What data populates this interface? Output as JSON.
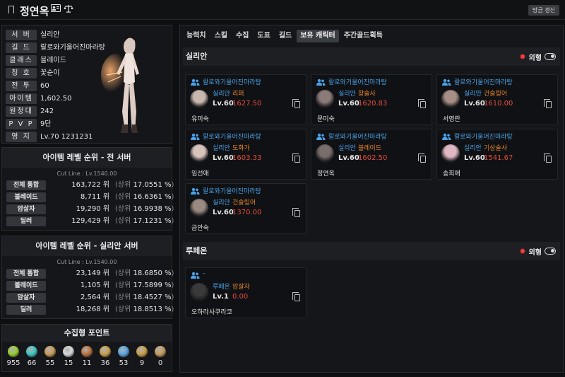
{
  "header": {
    "character_name": "정연옥",
    "refresh_label": "방금 갱신"
  },
  "profile": {
    "rows": [
      {
        "label": "서 버",
        "value": "실리안"
      },
      {
        "label": "길 드",
        "value": "랄로와기울어진마라탕"
      },
      {
        "label": "클래스",
        "value": "블레이드"
      },
      {
        "label": "칭 호",
        "value": "꽃순이"
      },
      {
        "label": "전 투",
        "value": "60"
      },
      {
        "label": "아이템",
        "value": "1,602.50"
      },
      {
        "label": "원정대",
        "value": "242"
      },
      {
        "label": "P V P",
        "value": "9단"
      },
      {
        "label": "영 지",
        "value": "Lv.70 1231231"
      }
    ]
  },
  "rank_all": {
    "title": "아이템 레벨 순위 - 전 서버",
    "cutline": "Cut Line : Lv.1540.00",
    "rows": [
      {
        "label": "전체 통합",
        "rank": "163,722",
        "unit": "위",
        "pct": "17.0551 %"
      },
      {
        "label": "블레이드",
        "rank": "8,711",
        "unit": "위",
        "pct": "16.6361 %"
      },
      {
        "label": "암살자",
        "rank": "19,290",
        "unit": "위",
        "pct": "16.9938 %"
      },
      {
        "label": "딜러",
        "rank": "129,429",
        "unit": "위",
        "pct": "17.1231 %"
      }
    ]
  },
  "rank_server": {
    "title": "아이템 레벨 순위 - 실리안 서버",
    "cutline": "Cut Line : Lv.1540.00",
    "rows": [
      {
        "label": "전체 통합",
        "rank": "23,149",
        "unit": "위",
        "pct": "18.6850 %"
      },
      {
        "label": "블레이드",
        "rank": "1,105",
        "unit": "위",
        "pct": "17.5899 %"
      },
      {
        "label": "암살자",
        "rank": "2,564",
        "unit": "위",
        "pct": "18.4527 %"
      },
      {
        "label": "딜러",
        "rank": "18,268",
        "unit": "위",
        "pct": "18.8513 %"
      }
    ]
  },
  "pct_prefix": "(상위",
  "pct_suffix": ")",
  "collect": {
    "title": "수집형 포인트",
    "items": [
      {
        "icon": "mokoko-seed-icon",
        "count": "955",
        "color": "#9acd32"
      },
      {
        "icon": "island-heart-icon",
        "count": "66",
        "color": "#3ec6c0"
      },
      {
        "icon": "great-art-icon",
        "count": "55",
        "color": "#c89b5a"
      },
      {
        "icon": "giant-heart-icon",
        "count": "15",
        "color": "#d9d9d9"
      },
      {
        "icon": "ignea-token-icon",
        "count": "11",
        "color": "#b8733e"
      },
      {
        "icon": "sea-bounty-icon",
        "count": "36",
        "color": "#c9a04a"
      },
      {
        "icon": "orpheus-star-icon",
        "count": "53",
        "color": "#5aa6e0"
      },
      {
        "icon": "world-tree-leaf-icon",
        "count": "9",
        "color": "#c9a04a"
      },
      {
        "icon": "omnium-star-icon",
        "count": "0",
        "color": "#c49a5c"
      }
    ]
  },
  "tabs": [
    "능력치",
    "스킬",
    "수집",
    "도표",
    "길드",
    "보유 캐릭터",
    "주간골드획득"
  ],
  "active_tab": 5,
  "servers": [
    {
      "name": "실리안",
      "appearance_label": "외형",
      "characters": [
        {
          "guild": "랄로와기울어진마라탕",
          "server": "실리안",
          "class": "리퍼",
          "level": "Lv.60",
          "ilvl": "1627.50",
          "name": "유미숙",
          "avatar": "#c9b8b0"
        },
        {
          "guild": "랄로와기울어진마라탕",
          "server": "실리안",
          "class": "창술사",
          "level": "Lv.60",
          "ilvl": "1620.83",
          "name": "문미숙",
          "avatar": "#8a7a78"
        },
        {
          "guild": "랄로와기울어진마라탕",
          "server": "실리안",
          "class": "건슬링어",
          "level": "Lv.60",
          "ilvl": "1610.00",
          "name": "서영란",
          "avatar": "#a88f86"
        },
        {
          "guild": "랄로와기울어진마라탕",
          "server": "실리안",
          "class": "도화가",
          "level": "Lv.60",
          "ilvl": "1603.33",
          "name": "임선애",
          "avatar": "#d8c2bc"
        },
        {
          "guild": "랄로와기울어진마라탕",
          "server": "실리안",
          "class": "블레이드",
          "level": "Lv.60",
          "ilvl": "1602.50",
          "name": "정연옥",
          "avatar": "#7a6e6c"
        },
        {
          "guild": "랄로와기울어진마라탕",
          "server": "실리안",
          "class": "기상술사",
          "level": "Lv.60",
          "ilvl": "1541.67",
          "name": "송희애",
          "avatar": "#e0b8c4"
        },
        {
          "guild": "랄로와기울어진마라탕",
          "server": "실리안",
          "class": "건슬링어",
          "level": "Lv.60",
          "ilvl": "1370.00",
          "name": "금안숙",
          "avatar": "#9a8a82"
        }
      ]
    },
    {
      "name": "루페온",
      "appearance_label": "외형",
      "characters": [
        {
          "guild": "-",
          "server": "루페온",
          "class": "암살자",
          "level": "Lv.1",
          "ilvl": "0.00",
          "name": "오하라사쿠라코",
          "avatar": "#3a3a3a"
        }
      ]
    }
  ]
}
